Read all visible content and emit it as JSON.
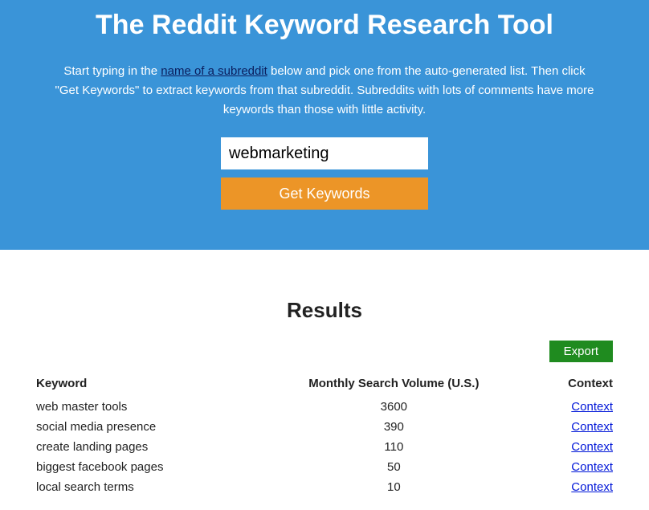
{
  "hero": {
    "title": "The Reddit Keyword Research Tool",
    "desc_pre": "Start typing in the ",
    "desc_link": "name of a subreddit",
    "desc_post": " below and pick one from the auto-generated list. Then click \"Get Keywords\" to extract keywords from that subreddit. Subreddits with lots of comments have more keywords than those with little activity.",
    "input_value": "webmarketing",
    "button_label": "Get Keywords"
  },
  "results": {
    "title": "Results",
    "export_label": "Export",
    "columns": {
      "keyword": "Keyword",
      "volume": "Monthly Search Volume (U.S.)",
      "context": "Context"
    },
    "context_link_label": "Context",
    "rows": [
      {
        "keyword": "web master tools",
        "volume": "3600"
      },
      {
        "keyword": "social media presence",
        "volume": "390"
      },
      {
        "keyword": "create landing pages",
        "volume": "110"
      },
      {
        "keyword": "biggest facebook pages",
        "volume": "50"
      },
      {
        "keyword": "local search terms",
        "volume": "10"
      }
    ]
  }
}
